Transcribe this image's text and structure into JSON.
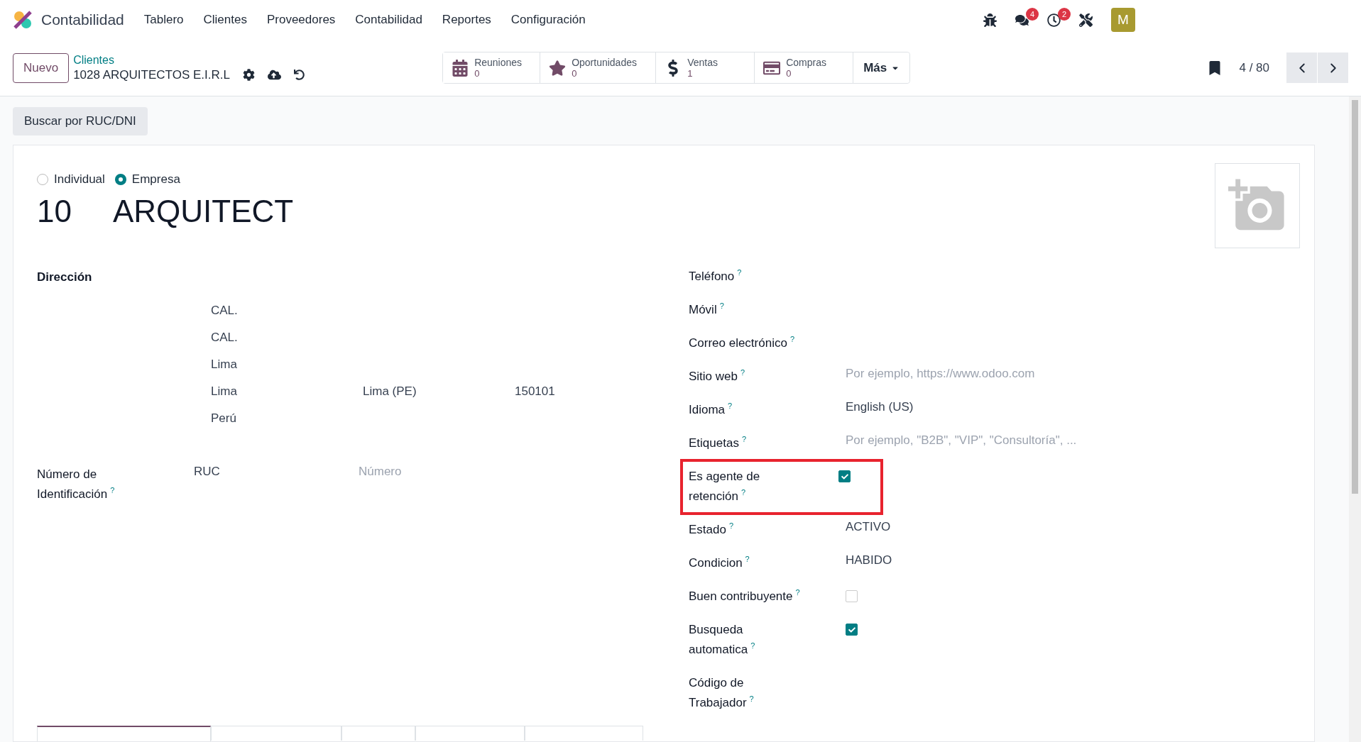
{
  "app": {
    "name": "Contabilidad"
  },
  "menu": [
    {
      "label": "Tablero"
    },
    {
      "label": "Clientes"
    },
    {
      "label": "Proveedores"
    },
    {
      "label": "Contabilidad"
    },
    {
      "label": "Reportes"
    },
    {
      "label": "Configuración"
    }
  ],
  "systray": [
    {
      "kind": "bug"
    },
    {
      "kind": "chat",
      "badge": "4"
    },
    {
      "kind": "activity",
      "badge": "2"
    },
    {
      "kind": "tools"
    }
  ],
  "avatar": {
    "initial": "M"
  },
  "control_panel": {
    "new_button": "Nuevo",
    "breadcrumb": "Clientes",
    "record_name": "1028 ARQUITECTOS E.I.R.L",
    "smart_buttons": [
      {
        "kind": "calendar",
        "label": "Reuniones",
        "value": "0"
      },
      {
        "kind": "star",
        "label": "Oportunidades",
        "value": "0"
      },
      {
        "kind": "dollar",
        "label": "Ventas",
        "value": "1"
      },
      {
        "kind": "card",
        "label": "Compras",
        "value": "0"
      }
    ],
    "more": "Más",
    "pager": "4 / 80"
  },
  "search_button": "Buscar por RUC/DNI",
  "form": {
    "company_type": [
      {
        "label": "Individual",
        "selected": false
      },
      {
        "label": "Empresa",
        "selected": true
      }
    ],
    "name_prefix": "10",
    "name": "ARQUITECT",
    "address": {
      "label": "Dirección",
      "lines": [
        [
          "CAL."
        ],
        [
          "CAL."
        ],
        [
          "Lima"
        ],
        [
          "Lima",
          "Lima (PE)",
          "150101"
        ],
        [
          "Perú"
        ]
      ]
    },
    "identification": {
      "label": "Número de Identificación",
      "help": "?",
      "type": "RUC",
      "placeholder": "Número"
    },
    "fields": [
      {
        "label": "Teléfono",
        "help": "?",
        "kind": "empty"
      },
      {
        "label": "Móvil",
        "help": "?",
        "kind": "empty"
      },
      {
        "label": "Correo electrónico",
        "help": "?",
        "kind": "empty"
      },
      {
        "label": "Sitio web",
        "help": "?",
        "kind": "input",
        "placeholder": "Por ejemplo, https://www.odoo.com"
      },
      {
        "label": "Idioma",
        "help": "?",
        "kind": "text",
        "value": "English (US)"
      },
      {
        "label": "Etiquetas",
        "help": "?",
        "kind": "input",
        "placeholder": "Por ejemplo, \"B2B\", \"VIP\", \"Consultoría\", ..."
      },
      {
        "label": "Es agente de retención",
        "help": "?",
        "kind": "checkbox",
        "checked": true,
        "highlighted": true
      },
      {
        "label": "Estado",
        "help": "?",
        "kind": "text",
        "value": "ACTIVO"
      },
      {
        "label": "Condicion",
        "help": "?",
        "kind": "text",
        "value": "HABIDO"
      },
      {
        "label": "Buen contribuyente",
        "help": "?",
        "kind": "checkbox",
        "checked": false
      },
      {
        "label": "Busqueda automatica",
        "help": "?",
        "kind": "checkbox",
        "checked": true
      },
      {
        "label": "Código de Trabajador",
        "help": "?",
        "kind": "empty"
      }
    ]
  },
  "tabs": [
    {
      "selected": true
    },
    {
      "selected": false
    },
    {
      "selected": false
    },
    {
      "selected": false
    },
    {
      "selected": false
    }
  ]
}
